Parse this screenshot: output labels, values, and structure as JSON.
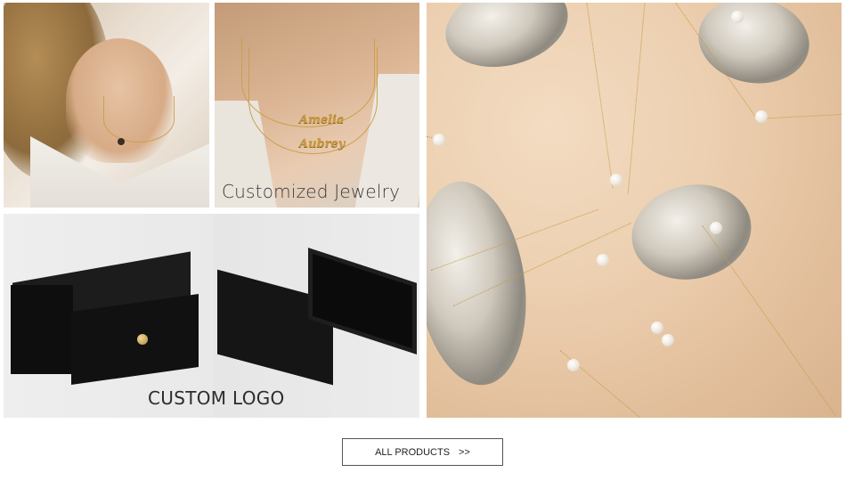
{
  "tiles": {
    "names": {
      "caption": "Customized Jewelry",
      "plate_1": "Amelia",
      "plate_2": "Aubrey"
    },
    "boxes": {
      "caption": "CUSTOM LOGO"
    }
  },
  "cta": {
    "label": "ALL PRODUCTS",
    "arrow": ">>"
  },
  "colors": {
    "gold": "#c59a3f",
    "box": "#141414",
    "satin": "#eccfb0"
  }
}
